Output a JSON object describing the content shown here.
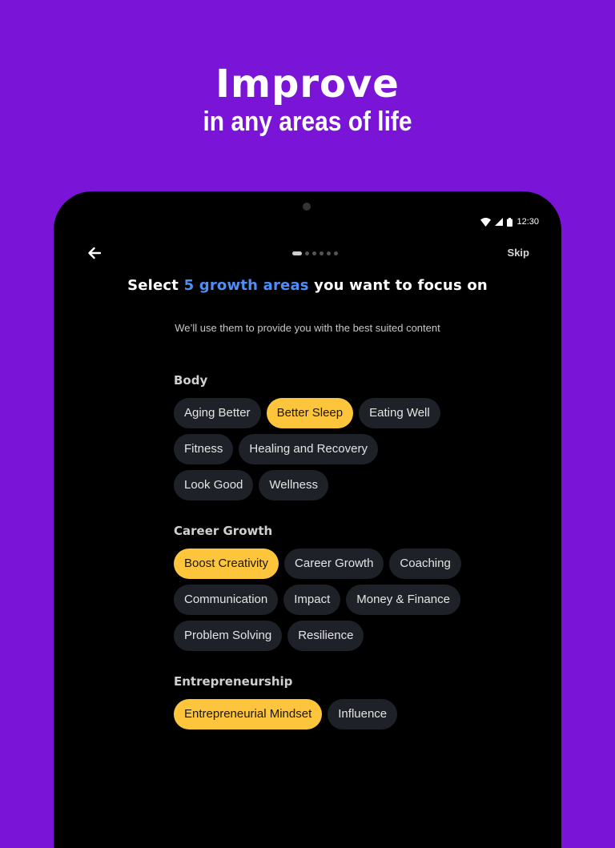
{
  "promo": {
    "title": "Improve",
    "subtitle": "in any areas of life"
  },
  "status_bar": {
    "time": "12:30",
    "icons": [
      "wifi-icon",
      "signal-icon",
      "battery-icon"
    ]
  },
  "nav": {
    "back_icon": "arrow-left-icon",
    "skip_label": "Skip",
    "pages": 6,
    "current_page": 1
  },
  "heading": {
    "prefix": "Select ",
    "accent": "5 growth areas",
    "suffix": " you want to focus on",
    "accent_color": "#4f8ef7"
  },
  "subheading": "We’ll use them to provide you with the best suited content",
  "colors": {
    "background": "#7a14d6",
    "chip": "#1f2128",
    "chip_selected": "#fcc53c"
  },
  "sections": [
    {
      "title": "Body",
      "chips": [
        {
          "label": "Aging Better",
          "selected": false
        },
        {
          "label": "Better Sleep",
          "selected": true
        },
        {
          "label": "Eating Well",
          "selected": false
        },
        {
          "label": "Fitness",
          "selected": false
        },
        {
          "label": "Healing and Recovery",
          "selected": false
        },
        {
          "label": "Look Good",
          "selected": false
        },
        {
          "label": "Wellness",
          "selected": false
        }
      ]
    },
    {
      "title": "Career Growth",
      "chips": [
        {
          "label": "Boost Creativity",
          "selected": true
        },
        {
          "label": "Career Growth",
          "selected": false
        },
        {
          "label": "Coaching",
          "selected": false
        },
        {
          "label": "Communication",
          "selected": false
        },
        {
          "label": "Impact",
          "selected": false
        },
        {
          "label": "Money & Finance",
          "selected": false
        },
        {
          "label": "Problem Solving",
          "selected": false
        },
        {
          "label": "Resilience",
          "selected": false
        }
      ]
    },
    {
      "title": "Entrepreneurship",
      "chips": [
        {
          "label": "Entrepreneurial Mindset",
          "selected": true
        },
        {
          "label": "Influence",
          "selected": false
        }
      ]
    }
  ]
}
